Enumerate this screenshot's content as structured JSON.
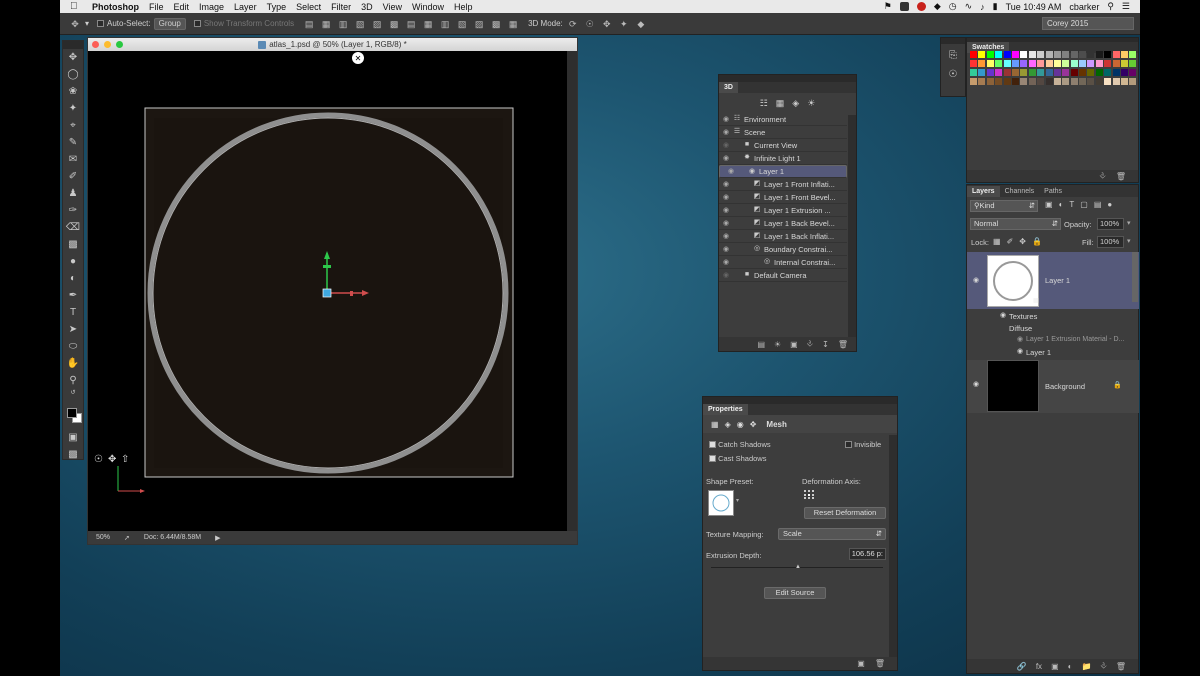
{
  "menubar": {
    "apple": "",
    "items": [
      "Photoshop",
      "File",
      "Edit",
      "Image",
      "Layer",
      "Type",
      "Select",
      "Filter",
      "3D",
      "View",
      "Window",
      "Help"
    ],
    "clock": "Tue 10:49 AM",
    "user": "cbarker"
  },
  "options": {
    "auto_select_label": "Auto-Select:",
    "auto_select_value": "Group",
    "transform_label": "Show Transform Controls",
    "mode_label": "3D Mode:",
    "workspace": "Corey 2015"
  },
  "document": {
    "title": "atlas_1.psd @ 50% (Layer 1, RGB/8) *",
    "zoom": "50%",
    "doc_info": "Doc: 6.44M/8.58M"
  },
  "panel3d": {
    "tab": "3D",
    "rows": [
      {
        "label": "Environment",
        "icon": "environment-icon",
        "indent": 0,
        "eye": true
      },
      {
        "label": "Scene",
        "icon": "scene-icon",
        "indent": 0,
        "eye": true
      },
      {
        "label": "Current View",
        "icon": "camera-icon",
        "indent": 1,
        "eye": false
      },
      {
        "label": "Infinite Light 1",
        "icon": "light-icon",
        "indent": 1,
        "eye": true
      },
      {
        "label": "Layer 1",
        "icon": "mesh-icon",
        "indent": 1,
        "eye": true,
        "selected": true
      },
      {
        "label": "Layer 1 Front Inflati...",
        "icon": "material-icon",
        "indent": 2,
        "eye": true
      },
      {
        "label": "Layer 1 Front Bevel...",
        "icon": "material-icon",
        "indent": 2,
        "eye": true
      },
      {
        "label": "Layer 1 Extrusion ...",
        "icon": "material-icon",
        "indent": 2,
        "eye": true
      },
      {
        "label": "Layer 1 Back Bevel...",
        "icon": "material-icon",
        "indent": 2,
        "eye": true
      },
      {
        "label": "Layer 1 Back Inflati...",
        "icon": "material-icon",
        "indent": 2,
        "eye": true
      },
      {
        "label": "Boundary Constrai...",
        "icon": "constraint-icon",
        "indent": 2,
        "eye": true
      },
      {
        "label": "Internal Constrai...",
        "icon": "constraint-icon",
        "indent": 3,
        "eye": true
      },
      {
        "label": "Default Camera",
        "icon": "camera-icon",
        "indent": 1,
        "eye": false
      }
    ]
  },
  "properties": {
    "tab": "Properties",
    "mode": "Mesh",
    "catch_shadows": "Catch Shadows",
    "cast_shadows": "Cast Shadows",
    "invisible": "Invisible",
    "shape_preset": "Shape Preset:",
    "deformation_axis": "Deformation Axis:",
    "reset_deformation": "Reset Deformation",
    "texture_mapping_label": "Texture Mapping:",
    "texture_mapping_value": "Scale",
    "extrusion_depth_label": "Extrusion Depth:",
    "extrusion_depth_value": "106.56 p:",
    "edit_source": "Edit Source"
  },
  "swatches": {
    "tab": "Swatches",
    "colors": [
      "#ff0000",
      "#ffff00",
      "#00ff00",
      "#00ffff",
      "#0000ff",
      "#ff00ff",
      "#ffffff",
      "#e6e6e6",
      "#cccccc",
      "#b3b3b3",
      "#999999",
      "#808080",
      "#666666",
      "#4d4d4d",
      "#333333",
      "#1a1a1a",
      "#000000",
      "#ff6666",
      "#ffcc66",
      "#99ff66",
      "#ff3333",
      "#ff9933",
      "#ffff66",
      "#66ff66",
      "#66ffff",
      "#6699ff",
      "#9966ff",
      "#ff66ff",
      "#ff9999",
      "#ffcc99",
      "#ffff99",
      "#ccff99",
      "#99ffcc",
      "#99ccff",
      "#cc99ff",
      "#ff99cc",
      "#cc3333",
      "#cc6633",
      "#cccc33",
      "#66cc33",
      "#33cc99",
      "#3399cc",
      "#6633cc",
      "#cc33cc",
      "#993333",
      "#996633",
      "#999933",
      "#339933",
      "#339999",
      "#336699",
      "#663399",
      "#993399",
      "#660000",
      "#663300",
      "#666600",
      "#006600",
      "#006666",
      "#003366",
      "#330066",
      "#660066",
      "#c69c6d",
      "#a67c52",
      "#8c6239",
      "#754c24",
      "#603913",
      "#42210b",
      "#998675",
      "#736357",
      "#534741",
      "#362f2d",
      "#c7b299",
      "#ab9a84",
      "#8e7f6f",
      "#726758",
      "#5a5045",
      "#433c33",
      "#f7e0c2",
      "#e0c9ae",
      "#d1b792",
      "#b39b7c"
    ]
  },
  "layers": {
    "tabs": [
      "Layers",
      "Channels",
      "Paths"
    ],
    "kind_label": "Kind",
    "blend_mode": "Normal",
    "opacity_label": "Opacity:",
    "opacity_value": "100%",
    "lock_label": "Lock:",
    "fill_label": "Fill:",
    "fill_value": "100%",
    "layer1_name": "Layer 1",
    "textures_label": "Textures",
    "diffuse_label": "Diffuse",
    "diffuse_item": "Layer 1 Extrusion Material - D...",
    "diffuse_item2": "Layer 1",
    "background_name": "Background"
  }
}
